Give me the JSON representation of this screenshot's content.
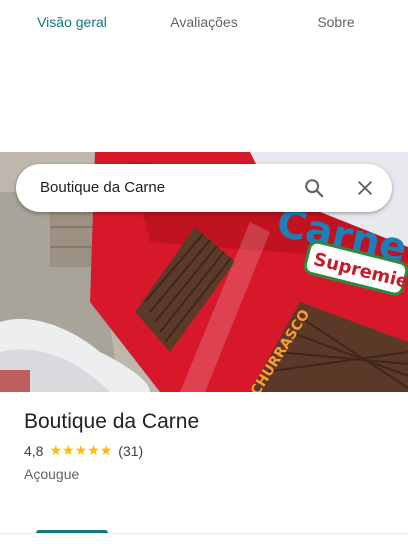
{
  "search": {
    "query": "Boutique da Carne"
  },
  "place": {
    "name": "Boutique da Carne",
    "rating": "4,8",
    "stars_filled": 5,
    "review_count": "(31)",
    "category": "Açougue"
  },
  "photo": {
    "sign_text": "Carne",
    "sticker_text": "Supremie",
    "awning_text": "CHURRASCO"
  },
  "tabs": [
    {
      "label": "Visão geral",
      "active": true
    },
    {
      "label": "Avaliações",
      "active": false
    },
    {
      "label": "Sobre",
      "active": false
    }
  ],
  "colors": {
    "accent": "#137680",
    "star": "#fbbc04",
    "storefront_red": "#d7182a"
  },
  "icons": {
    "search": "search-icon",
    "close": "close-icon",
    "star": "star-icon"
  }
}
